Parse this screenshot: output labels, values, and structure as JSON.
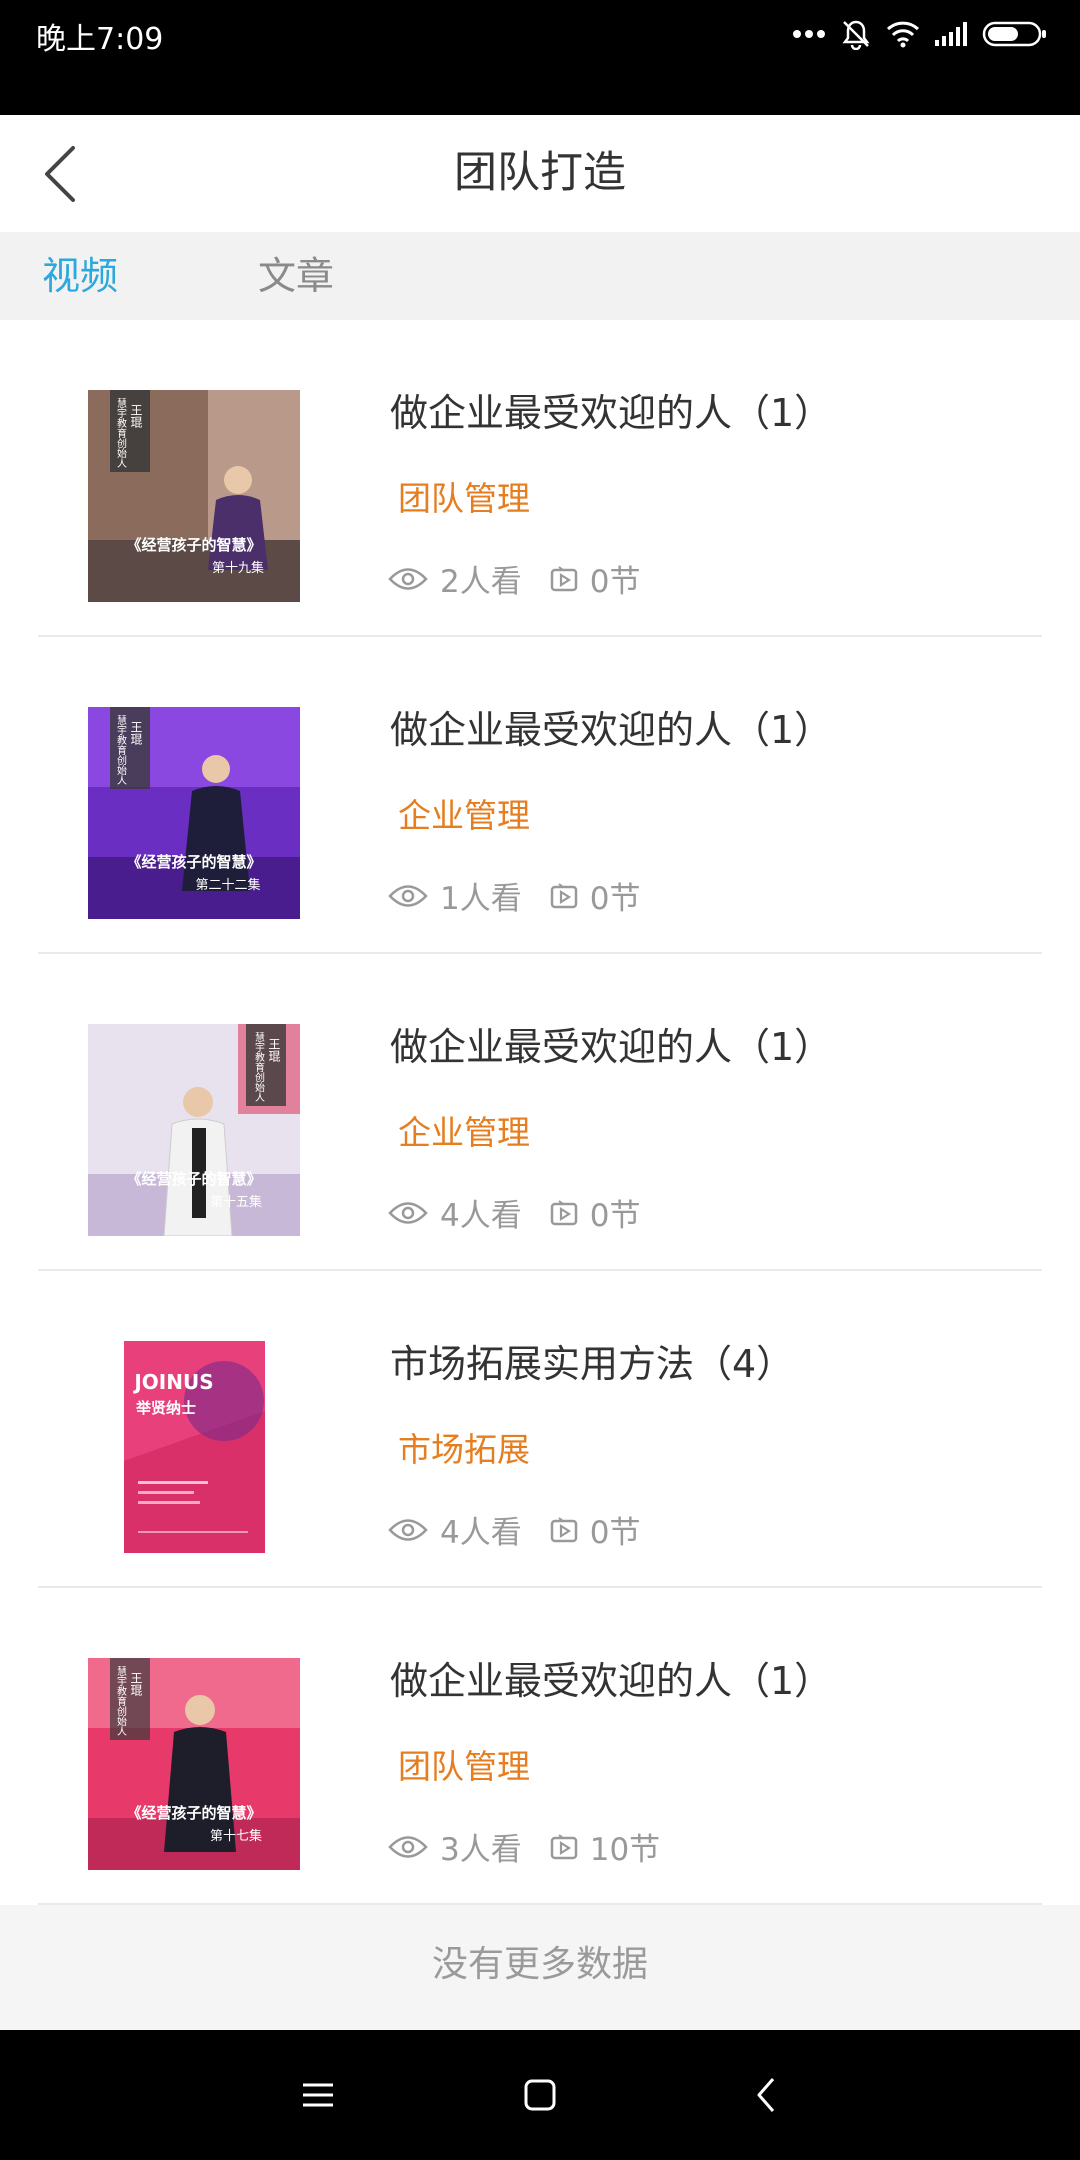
{
  "status_bar": {
    "time": "晚上7:09",
    "icons": [
      "more-dots-icon",
      "silent-bell-icon",
      "wifi-icon",
      "signal-icon",
      "battery-icon"
    ]
  },
  "header": {
    "title": "团队打造",
    "back_icon": "chevron-left-icon"
  },
  "tabs": [
    {
      "label": "视频",
      "active": true
    },
    {
      "label": "文章",
      "active": false
    }
  ],
  "items": [
    {
      "title": "做企业最受欢迎的人（1）",
      "tag": "团队管理",
      "views": "2人看",
      "sections": "0节",
      "thumb": {
        "name": "王琨",
        "role": "慧宇教育创始人",
        "series": "《经营孩子的智慧》",
        "episode": "第十九集"
      }
    },
    {
      "title": "做企业最受欢迎的人（1）",
      "tag": "企业管理",
      "views": "1人看",
      "sections": "0节",
      "thumb": {
        "name": "王琨",
        "role": "慧宇教育创始人",
        "series": "《经营孩子的智慧》",
        "episode": "第二十二集"
      }
    },
    {
      "title": "做企业最受欢迎的人（1）",
      "tag": "企业管理",
      "views": "4人看",
      "sections": "0节",
      "thumb": {
        "name": "王琨",
        "role": "慧宇教育创始人",
        "series": "《经营孩子的智慧》",
        "episode": "第十五集"
      }
    },
    {
      "title": "市场拓展实用方法（4）",
      "tag": "市场拓展",
      "views": "4人看",
      "sections": "0节",
      "thumb": {
        "brand": "JOINUS",
        "headline": "举贤纳士"
      }
    },
    {
      "title": "做企业最受欢迎的人（1）",
      "tag": "团队管理",
      "views": "3人看",
      "sections": "10节",
      "thumb": {
        "name": "王琨",
        "role": "慧宇教育创始人",
        "series": "《经营孩子的智慧》",
        "episode": "第十七集"
      }
    }
  ],
  "footer": {
    "text": "没有更多数据"
  },
  "nav_bar": {
    "icons": [
      "menu-icon",
      "home-square-icon",
      "back-chevron-icon"
    ]
  },
  "colors": {
    "accent": "#2ba8dd",
    "tag": "#e67d1f",
    "meta": "#999999",
    "divider": "#e9e9e9"
  }
}
